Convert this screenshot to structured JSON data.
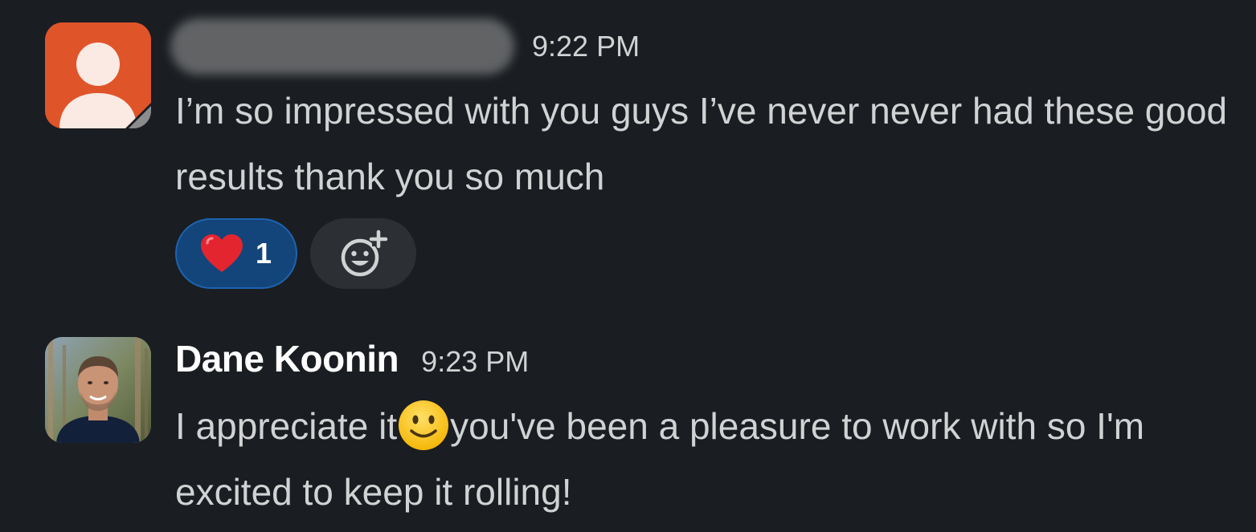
{
  "messages": [
    {
      "sender": "",
      "time": "9:22 PM",
      "text": "I’m so impressed with you guys   I’ve never never had these good results thank you so much",
      "avatar_icon": "default-user-avatar-icon",
      "avatar_color": "#e0542a",
      "reactions": [
        {
          "emoji_icon": "red-heart-icon",
          "count": "1"
        }
      ],
      "add_reaction_icon": "add-emoji-icon"
    },
    {
      "sender": "Dane Koonin",
      "time": "9:23 PM",
      "text_before_emoji": "I appreciate it",
      "inline_emoji_icon": "slightly-smiling-face-icon",
      "text_after_emoji": "you've been a pleasure to work with so I'm excited to keep it rolling!",
      "avatar_icon": "profile-photo"
    }
  ],
  "colors": {
    "background": "#1a1d21",
    "text": "#d1d2d3",
    "reaction_active_bg": "#13457a",
    "reaction_active_border": "#1d63b0"
  }
}
